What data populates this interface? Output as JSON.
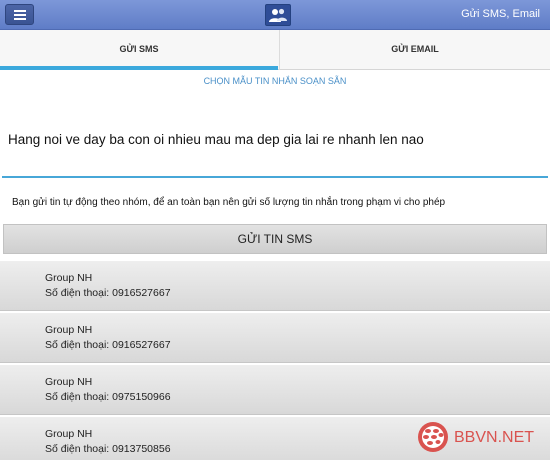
{
  "header": {
    "title": "Gửi SMS, Email",
    "menu_icon": "menu-icon",
    "logo_icon": "contacts-icon"
  },
  "tabs": [
    {
      "label": "GỬI SMS",
      "active": true
    },
    {
      "label": "GỬI EMAIL",
      "active": false
    }
  ],
  "template_link": "CHỌN MẪU TIN NHẮN SOẠN SẴN",
  "message": {
    "value": "Hang noi ve day ba con oi nhieu mau ma dep gia lai re nhanh len nao"
  },
  "notice": "Bạn gửi tin tự động theo nhóm, để an toàn bạn nên gửi số lượng tin nhắn trong phạm vi cho phép",
  "send_button": "GỬI TIN SMS",
  "contacts": [
    {
      "name": "Group NH",
      "phone": "Số điện thoại: 0916527667"
    },
    {
      "name": "Group NH",
      "phone": "Số điện thoại: 0916527667"
    },
    {
      "name": "Group NH",
      "phone": "Số điện thoại: 0975150966"
    },
    {
      "name": "Group NH",
      "phone": "Số điện thoại: 0913750856"
    }
  ],
  "watermark": {
    "text": "BBVN.NET",
    "icon": "blackberry-logo-icon"
  },
  "colors": {
    "header": "#6f8bd0",
    "accent": "#3ba9dd",
    "watermark": "#d9534f"
  }
}
